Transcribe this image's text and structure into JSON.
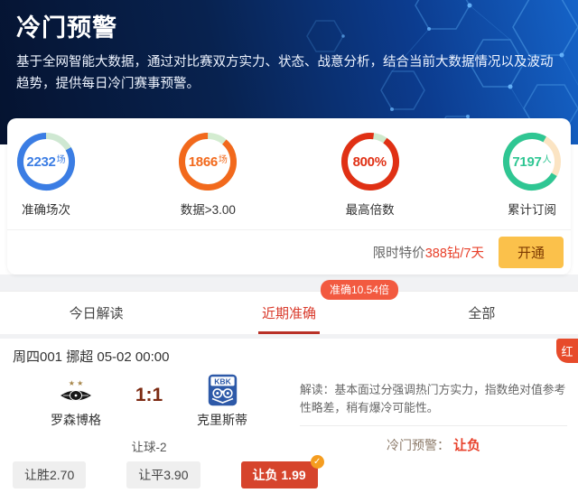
{
  "banner": {
    "title": "冷门预警",
    "description": "基于全网智能大数据，通过对比赛双方实力、状态、战意分析，结合当前大数据情况以及波动趋势，提供每日冷门赛事预警。"
  },
  "stats": [
    {
      "value": "2232",
      "unit": "场",
      "label": "准确场次",
      "color": "#3b7de4"
    },
    {
      "value": "1866",
      "unit": "场",
      "label": "数据>3.00",
      "color": "#f2691c"
    },
    {
      "value": "800%",
      "unit": "",
      "label": "最高倍数",
      "color": "#e03014"
    },
    {
      "value": "7197",
      "unit": "人",
      "label": "累计订阅",
      "color": "#2fc693"
    }
  ],
  "subscribe": {
    "price_prefix": "限时特价",
    "price_value": "388钻/7天",
    "button_label": "开通",
    "button_color": "#fbc14b"
  },
  "accuracy_badge": "准确10.54倍",
  "tabs": [
    {
      "label": "今日解读"
    },
    {
      "label": "近期准确"
    },
    {
      "label": "全部"
    }
  ],
  "active_tab": "近期准确",
  "match": {
    "header": "周四001 挪超 05-02 00:00",
    "result_tag": "红",
    "home_name": "罗森博格",
    "away_name": "克里斯蒂",
    "away_logo_text": "KBK",
    "score": "1:1",
    "handicap": "让球-2",
    "analysis_label": "解读：",
    "analysis_text": "基本面过分强调热门方实力，指数绝对值参考性略差，稍有爆冷可能性。",
    "warning_label": "冷门预警：",
    "warning_value": "让负",
    "odds": [
      {
        "label": "让胜2.70",
        "selected": false
      },
      {
        "label": "让平3.90",
        "selected": false
      },
      {
        "label": "让负 1.99",
        "selected": true
      }
    ],
    "check_icon": "✓"
  },
  "colors": {
    "accent_red": "#e8402a",
    "tag_red": "#e74b2b",
    "selected_odds_red": "#d6442c",
    "badge_orange": "#f59d20",
    "score_maroon": "#7c2a12"
  }
}
